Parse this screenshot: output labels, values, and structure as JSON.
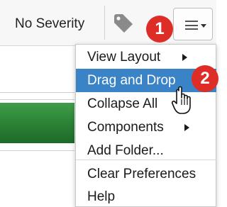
{
  "toolbar": {
    "severity_label": "No Severity",
    "tag_icon": "tag-icon",
    "menu_icon": "hamburger-menu-icon"
  },
  "badges": {
    "step1": "1",
    "step2": "2",
    "color": "#de2d26"
  },
  "menu": {
    "items": [
      {
        "label": "View Layout",
        "submenu": true
      },
      {
        "label": "Drag and Drop",
        "active": true
      },
      {
        "label": "Collapse All"
      },
      {
        "label": "Components",
        "submenu": true
      },
      {
        "label": "Add Folder..."
      },
      {
        "label": "Clear Preferences"
      },
      {
        "label": "Help"
      }
    ],
    "highlight_color": "#3b83c7"
  },
  "cursor_icon": "hand-pointer-icon"
}
